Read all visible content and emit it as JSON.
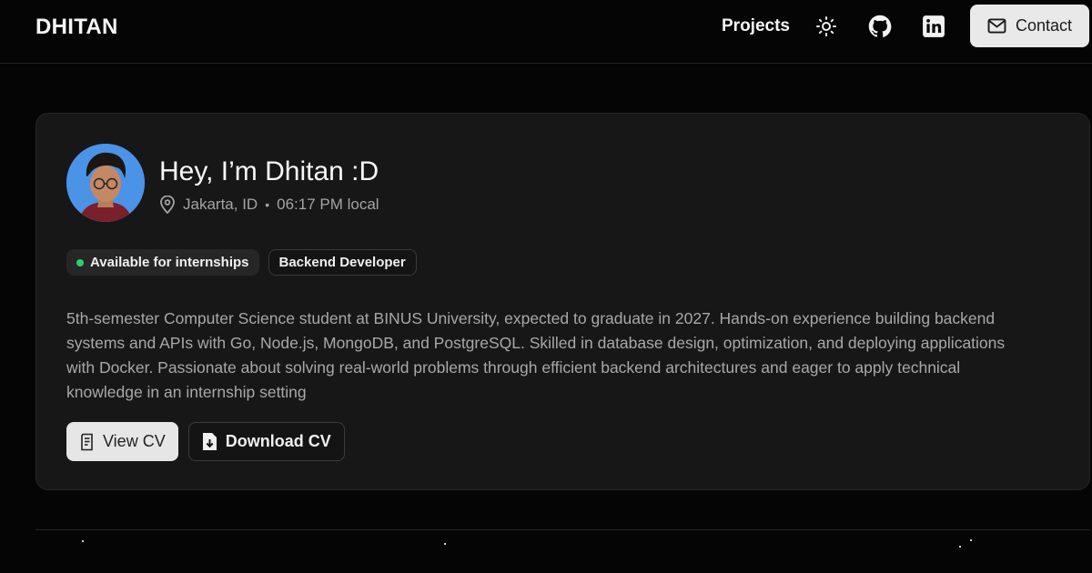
{
  "header": {
    "brand": "DHITAN",
    "nav_projects": "Projects",
    "contact_label": "Contact",
    "icons": [
      "sun-icon",
      "github-icon",
      "linkedin-icon",
      "mail-icon"
    ]
  },
  "profile": {
    "greeting": "Hey, I’m Dhitan :D",
    "location": "Jakarta, ID",
    "separator": "•",
    "local_time": "06:17 PM local",
    "badges": {
      "available": "Available for internships",
      "role": "Backend Developer"
    },
    "bio": "5th-semester Computer Science student at BINUS University, expected to graduate in 2027. Hands-on experience building backend systems and APIs with Go, Node.js, MongoDB, and PostgreSQL. Skilled in database design, optimization, and deploying applications with Docker. Passionate about solving real-world problems through efficient backend architectures and eager to apply technical knowledge in an internship setting",
    "actions": {
      "view_cv": "View CV",
      "download_cv": "Download CV"
    }
  },
  "colors": {
    "background": "#050505",
    "card": "#171717",
    "status_green": "#2ecc71",
    "avatar_bg": "#4b93e6",
    "contact_bg": "#e9e9e9"
  }
}
